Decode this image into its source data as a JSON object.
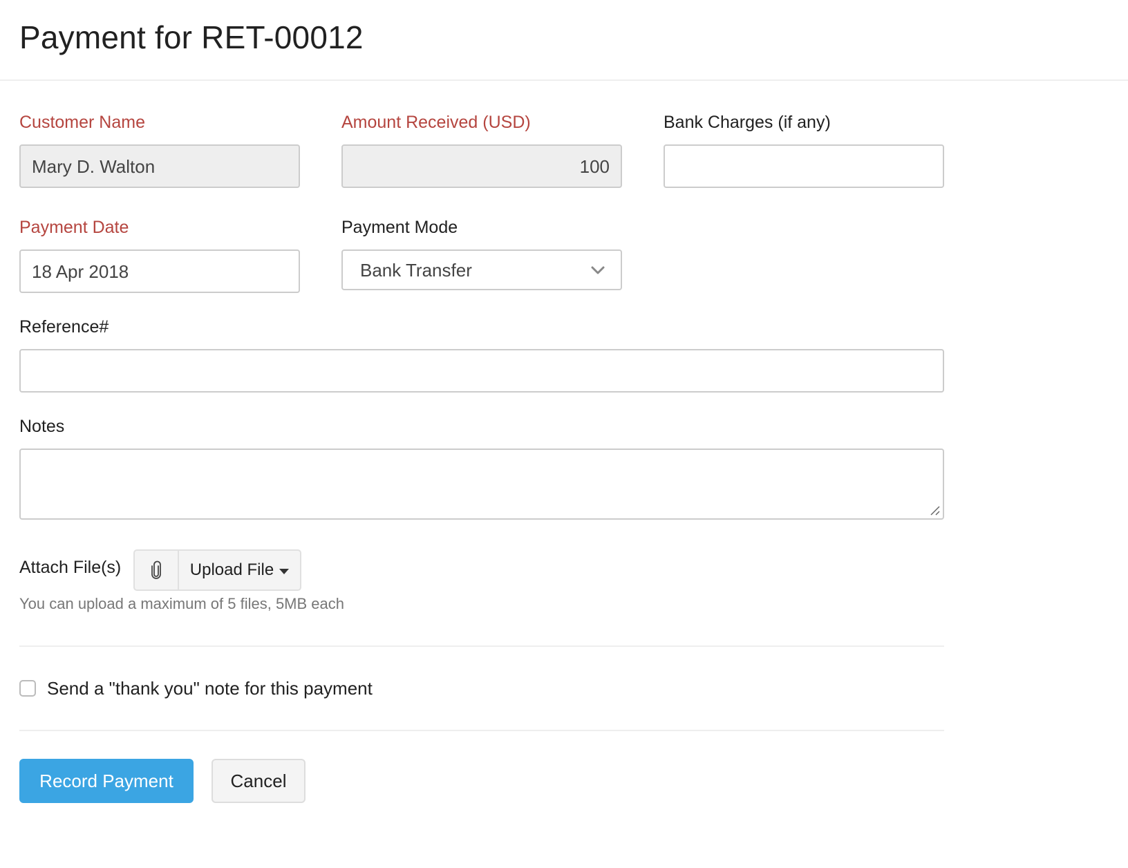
{
  "page": {
    "title": "Payment for RET-00012"
  },
  "form": {
    "customer_name": {
      "label": "Customer Name",
      "value": "Mary D. Walton",
      "required": true
    },
    "amount_received": {
      "label": "Amount Received (USD)",
      "value": "100",
      "required": true
    },
    "bank_charges": {
      "label": "Bank Charges (if any)",
      "value": ""
    },
    "payment_date": {
      "label": "Payment Date",
      "value": "18 Apr 2018",
      "required": true
    },
    "payment_mode": {
      "label": "Payment Mode",
      "value": "Bank Transfer",
      "icon": "chevron-down-icon"
    },
    "reference": {
      "label": "Reference#",
      "value": ""
    },
    "notes": {
      "label": "Notes",
      "value": ""
    },
    "attach": {
      "label": "Attach File(s)",
      "icon": "paperclip-icon",
      "upload_label": "Upload File",
      "help_text": "You can upload a maximum of 5 files, 5MB each"
    },
    "thank_you": {
      "label": "Send a \"thank you\" note for this payment",
      "checked": false
    }
  },
  "actions": {
    "primary_label": "Record Payment",
    "cancel_label": "Cancel"
  },
  "colors": {
    "required_label": "#b5453f",
    "primary_button": "#3ba5e3",
    "readonly_field": "#eeeeee"
  }
}
